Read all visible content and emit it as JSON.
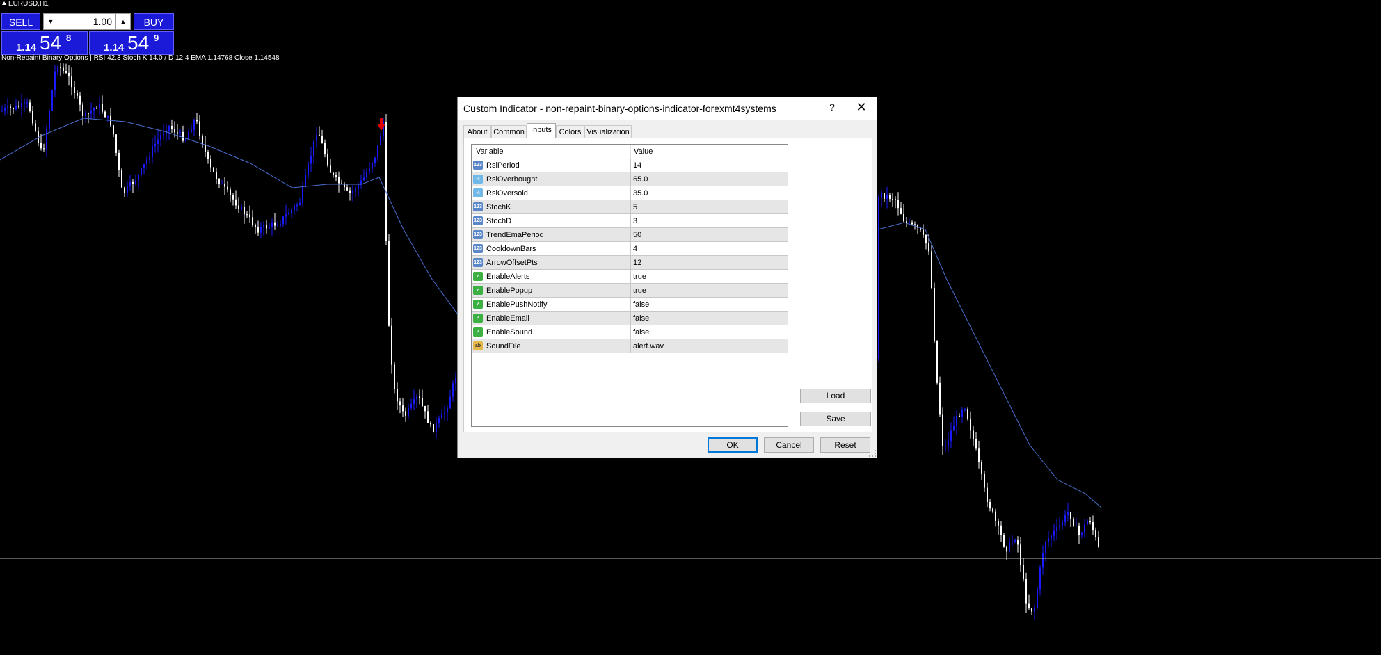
{
  "chart": {
    "symbol": "EURUSD,H1",
    "indicator_info": "Non-Repaint Binary Options | RSI 42.3  Stoch K 14.0 / D 12.4  EMA 1.14768  Close 1.14548",
    "colors": {
      "bull_candle": "#1a1aff",
      "bear_candle": "#ffffff",
      "ema_line": "#4a6fd0",
      "arrow": "#e00000",
      "hline": "#b0b0b0"
    }
  },
  "trade_panel": {
    "sell_label": "SELL",
    "buy_label": "BUY",
    "lot": "1.00",
    "sell_price": {
      "big": "1.14",
      "main": "54",
      "sup": "8"
    },
    "buy_price": {
      "big": "1.14",
      "main": "54",
      "sup": "9"
    }
  },
  "dialog": {
    "title": "Custom Indicator - non-repaint-binary-options-indicator-forexmt4systems",
    "help_label": "?",
    "close_label": "✕",
    "tabs": [
      "About",
      "Common",
      "Inputs",
      "Colors",
      "Visualization"
    ],
    "active_tab": "Inputs",
    "columns": [
      "Variable",
      "Value"
    ],
    "params": [
      {
        "icon": "int",
        "icon_text": "123",
        "name": "RsiPeriod",
        "value": "14"
      },
      {
        "icon": "dbl",
        "icon_text": "½",
        "name": "RsiOverbought",
        "value": "65.0"
      },
      {
        "icon": "dbl",
        "icon_text": "½",
        "name": "RsiOversold",
        "value": "35.0"
      },
      {
        "icon": "int",
        "icon_text": "123",
        "name": "StochK",
        "value": "5"
      },
      {
        "icon": "int",
        "icon_text": "123",
        "name": "StochD",
        "value": "3"
      },
      {
        "icon": "int",
        "icon_text": "123",
        "name": "TrendEmaPeriod",
        "value": "50"
      },
      {
        "icon": "int",
        "icon_text": "123",
        "name": "CooldownBars",
        "value": "4"
      },
      {
        "icon": "int",
        "icon_text": "123",
        "name": "ArrowOffsetPts",
        "value": "12"
      },
      {
        "icon": "bool",
        "icon_text": "✓",
        "name": "EnableAlerts",
        "value": "true"
      },
      {
        "icon": "bool",
        "icon_text": "✓",
        "name": "EnablePopup",
        "value": "true"
      },
      {
        "icon": "bool",
        "icon_text": "✓",
        "name": "EnablePushNotify",
        "value": "false"
      },
      {
        "icon": "bool",
        "icon_text": "✓",
        "name": "EnableEmail",
        "value": "false"
      },
      {
        "icon": "bool",
        "icon_text": "✓",
        "name": "EnableSound",
        "value": "false"
      },
      {
        "icon": "str",
        "icon_text": "ab",
        "name": "SoundFile",
        "value": "alert.wav"
      }
    ],
    "load_label": "Load",
    "save_label": "Save",
    "ok_label": "OK",
    "cancel_label": "Cancel",
    "reset_label": "Reset"
  }
}
